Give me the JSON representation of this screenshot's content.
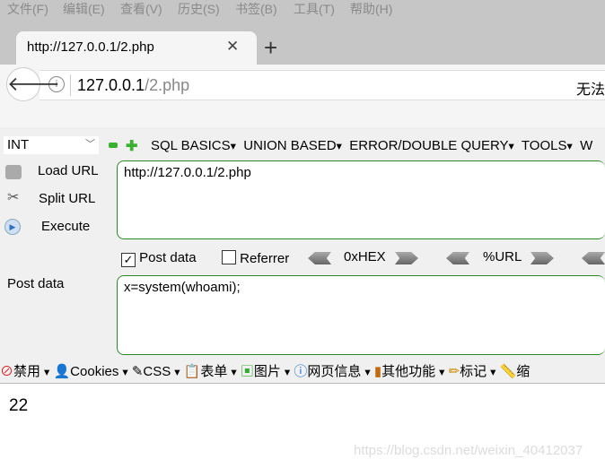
{
  "menu": [
    "文件(F)",
    "编辑(E)",
    "查看(V)",
    "历史(S)",
    "书签(B)",
    "工具(T)",
    "帮助(H)"
  ],
  "tab": {
    "title": "http://127.0.0.1/2.php",
    "close": "✕",
    "new": "+"
  },
  "address": {
    "host": "127.0.0.1",
    "path": "/2.php",
    "right_text": "无法"
  },
  "hackbar": {
    "select": "INT",
    "menus": [
      "SQL BASICS",
      "UNION BASED",
      "ERROR/DOUBLE QUERY",
      "TOOLS",
      "W"
    ],
    "load_url": "Load URL",
    "split_url": "Split URL",
    "execute": "Execute",
    "url_value": "http://127.0.0.1/2.php",
    "post_data_checked": true,
    "post_data_label": "Post data",
    "referrer_label": "Referrer",
    "referrer_checked": false,
    "hex": "0xHEX",
    "url_enc": "%URL",
    "post_label": "Post data",
    "post_value": "x=system(whoami);"
  },
  "toolbar": [
    "禁用",
    "Cookies",
    "CSS",
    "表单",
    "图片",
    "网页信息",
    "其他功能",
    "标记",
    "缩"
  ],
  "content": {
    "output": "22"
  },
  "watermark": "https://blog.csdn.net/weixin_40412037"
}
